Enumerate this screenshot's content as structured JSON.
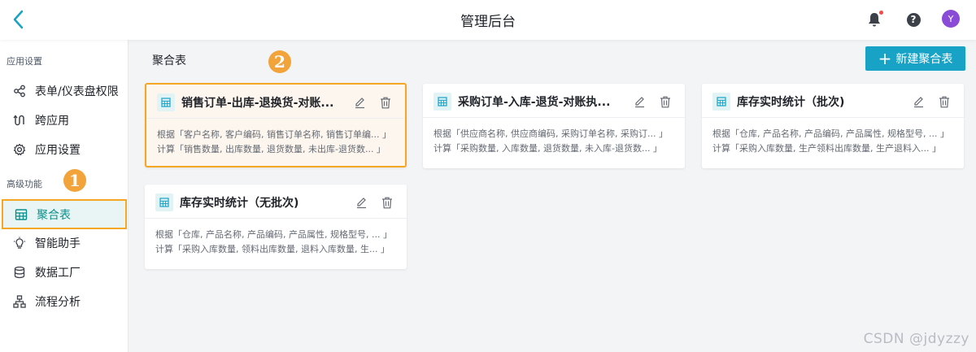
{
  "header": {
    "title": "管理后台",
    "avatar_letter": "Y"
  },
  "sidebar": {
    "sections": [
      {
        "title": "应用设置"
      },
      {
        "title": "高级功能"
      }
    ],
    "items": [
      {
        "label": "表单/仪表盘权限",
        "icon": "share-nodes-icon"
      },
      {
        "label": "跨应用",
        "icon": "cross-app-icon"
      },
      {
        "label": "应用设置",
        "icon": "gear-icon"
      },
      {
        "label": "聚合表",
        "icon": "table-icon",
        "active": true
      },
      {
        "label": "智能助手",
        "icon": "lightbulb-icon"
      },
      {
        "label": "数据工厂",
        "icon": "database-icon"
      },
      {
        "label": "流程分析",
        "icon": "flow-chart-icon"
      }
    ]
  },
  "annotations": {
    "badge1": "1",
    "badge2": "2"
  },
  "main": {
    "title": "聚合表",
    "new_button": "新建聚合表"
  },
  "cards": [
    {
      "title": "销售订单-出库-退换货-对账...",
      "line1": "根据「客户名称, 客户编码, 销售订单名称, 销售订单编...  」",
      "line2": "计算「销售数量, 出库数量, 退货数量, 未出库-退货数...    」"
    },
    {
      "title": "采购订单-入库-退货-对账执...",
      "line1": "根据「供应商名称, 供应商编码, 采购订单名称, 采购订...  」",
      "line2": "计算「采购数量, 入库数量, 退货数量, 未入库-退货数...    」"
    },
    {
      "title": "库存实时统计（批次)",
      "line1": "根据「仓库, 产品名称, 产品编码, 产品属性, 规格型号, ...  」",
      "line2": "计算「采购入库数量, 生产领料出库数量, 生产退料入...      」"
    },
    {
      "title": "库存实时统计（无批次)",
      "line1": "根据「仓库, 产品名称, 产品编码, 产品属性, 规格型号, ...  」",
      "line2": "计算「采购入库数量, 领料出库数量, 退料入库数量, 生...  」"
    }
  ],
  "watermark": "CSDN @jdyzzy",
  "colors": {
    "accent": "#17a2c6",
    "highlight": "#f5a623",
    "avatar": "#8a4bd6"
  }
}
